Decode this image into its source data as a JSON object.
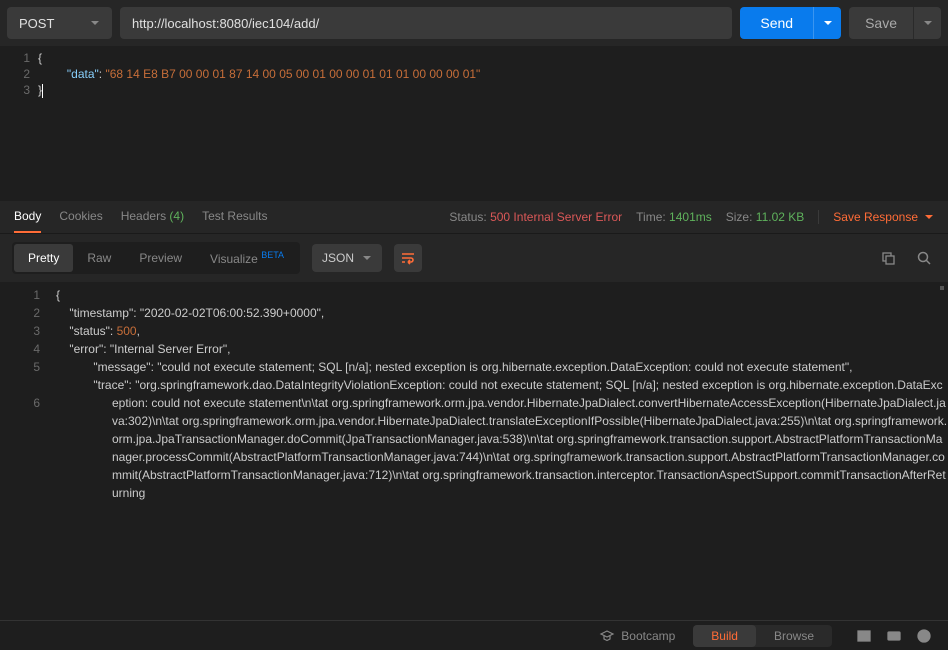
{
  "request": {
    "method": "POST",
    "url": "http://localhost:8080/iec104/add/",
    "send_label": "Send",
    "save_label": "Save",
    "body_lines": [
      "1",
      "2",
      "3"
    ],
    "body_key": "\"data\"",
    "body_value": "\"68 14 E8 B7 00 00 01 87 14 00 05 00 01 00 00 01 01 01 00 00 00 01\""
  },
  "response_meta": {
    "tabs": {
      "body": "Body",
      "cookies": "Cookies",
      "headers": "Headers",
      "headers_count": "(4)",
      "test_results": "Test Results"
    },
    "status_label": "Status:",
    "status_value": "500 Internal Server Error",
    "time_label": "Time:",
    "time_value": "1401ms",
    "size_label": "Size:",
    "size_value": "11.02 KB",
    "save_response": "Save Response"
  },
  "response_toolbar": {
    "pretty": "Pretty",
    "raw": "Raw",
    "preview": "Preview",
    "visualize": "Visualize",
    "beta": "BETA",
    "format": "JSON"
  },
  "response_body": {
    "line_numbers": [
      "1",
      "2",
      "3",
      "4",
      "5",
      "6"
    ],
    "timestamp_key": "\"timestamp\"",
    "timestamp_val": "\"2020-02-02T06:00:52.390+0000\"",
    "status_key": "\"status\"",
    "status_val": "500",
    "error_key": "\"error\"",
    "error_val": "\"Internal Server Error\"",
    "message_key": "\"message\"",
    "message_val_pre": "\"could not execute statement; SQL [n",
    "message_link": "/a];",
    "message_val_post": " nested exception is org.hibernate.exception.DataException: could not execute statement\"",
    "trace_key": "\"trace\"",
    "trace_val_pre": "\"org.springframework.dao.DataIntegrityViolationException: could not execute statement; SQL [n",
    "trace_link": "/a];",
    "trace_val_post": " nested exception is org.hibernate.exception.DataException: could not execute statement\\n\\tat org.springframework.orm.jpa.vendor.HibernateJpaDialect.convertHibernateAccessException(HibernateJpaDialect.java:302)\\n\\tat org.springframework.orm.jpa.vendor.HibernateJpaDialect.translateExceptionIfPossible(HibernateJpaDialect.java:255)\\n\\tat org.springframework.orm.jpa.JpaTransactionManager.doCommit(JpaTransactionManager.java:538)\\n\\tat org.springframework.transaction.support.AbstractPlatformTransactionManager.processCommit(AbstractPlatformTransactionManager.java:744)\\n\\tat org.springframework.transaction.support.AbstractPlatformTransactionManager.commit(AbstractPlatformTransactionManager.java:712)\\n\\tat org.springframework.transaction.interceptor.TransactionAspectSupport.commitTransactionAfterReturning"
  },
  "bottom": {
    "bootcamp": "Bootcamp",
    "build": "Build",
    "browse": "Browse"
  }
}
